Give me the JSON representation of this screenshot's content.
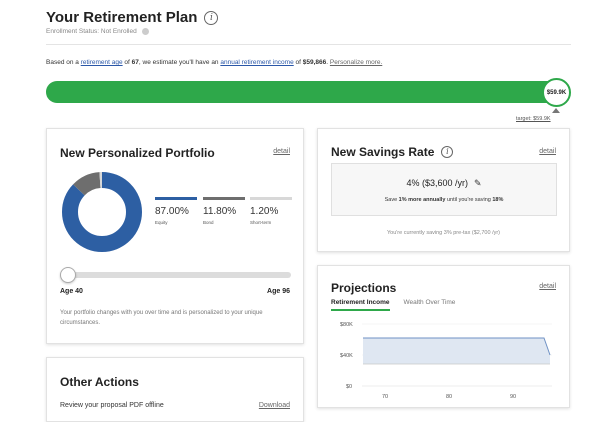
{
  "header": {
    "title": "Your Retirement Plan",
    "info_icon": "i",
    "enrollment_status": "Enrollment Status: Not Enrolled"
  },
  "estimate": {
    "prefix": "Based on a ",
    "link_retirement_age": "retirement age",
    "mid1": " of ",
    "age": "67",
    "mid2": ", we estimate you'll have an ",
    "link_income": "annual retirement income",
    "mid3": " of ",
    "amount": "$59,866",
    "mid4": ". ",
    "link_personalize": "Personalize more."
  },
  "progress": {
    "fraction": 1.0,
    "knob_label": "$59.9K",
    "target_label": "target: $59.9K",
    "color": "#2ea84a"
  },
  "portfolio": {
    "title": "New Personalized Portfolio",
    "detail_label": "detail",
    "allocations": [
      {
        "percent": "87.00%",
        "value": 87.0,
        "label": "Equity",
        "color": "#2d5fa3"
      },
      {
        "percent": "11.80%",
        "value": 11.8,
        "label": "Bond",
        "color": "#6e6e6e"
      },
      {
        "percent": "1.20%",
        "value": 1.2,
        "label": "Short-term",
        "color": "#d8d8d8"
      }
    ],
    "age_start_label": "Age 40",
    "age_end_label": "Age 96",
    "note": "Your portfolio changes with you over time and is personalized to your unique circumstances."
  },
  "actions": {
    "title": "Other Actions",
    "review_label": "Review your proposal PDF offline",
    "download_label": "Download"
  },
  "savings": {
    "title": "New Savings Rate",
    "info_icon": "i",
    "detail_label": "detail",
    "rate_value": "4% ($3,600 /yr)",
    "rate_sub_prefix": "Save ",
    "rate_sub_bold1": "1% more annually",
    "rate_sub_mid": " until you're saving ",
    "rate_sub_bold2": "18%",
    "current_note": "You're currently saving 3% pre-tax ($2,700 /yr)"
  },
  "projections": {
    "title": "Projections",
    "detail_label": "detail",
    "tabs": [
      "Retirement Income",
      "Wealth Over Time"
    ],
    "active_tab": 0,
    "y_ticks": [
      "$80K",
      "$40K",
      "$0"
    ],
    "x_ticks": [
      "70",
      "80",
      "90"
    ],
    "accent": "#2ea84a",
    "area_color": "#dfe7f2",
    "line_color": "#6f91c4"
  }
}
